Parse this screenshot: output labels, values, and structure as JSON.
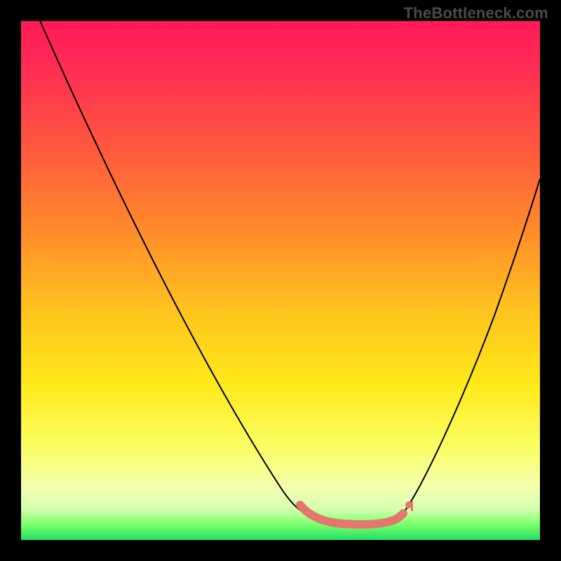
{
  "watermark": {
    "text": "TheBottleneck.com"
  },
  "chart_data": {
    "type": "line",
    "title": "",
    "xlabel": "",
    "ylabel": "",
    "xlim": [
      0,
      100
    ],
    "ylim": [
      0,
      100
    ],
    "series": [
      {
        "name": "bottleneck-curve",
        "x": [
          2,
          10,
          20,
          30,
          40,
          48,
          54,
          58,
          62,
          66,
          70,
          74,
          80,
          88,
          96
        ],
        "values": [
          100,
          84,
          68,
          52,
          36,
          22,
          12,
          7,
          5,
          5,
          6,
          10,
          22,
          45,
          72
        ]
      }
    ],
    "highlight_range_x": [
      54,
      74
    ],
    "background_gradient": {
      "top": "#ff1a5a",
      "mid": "#ffe91a",
      "bottom": "#23e06a"
    }
  }
}
